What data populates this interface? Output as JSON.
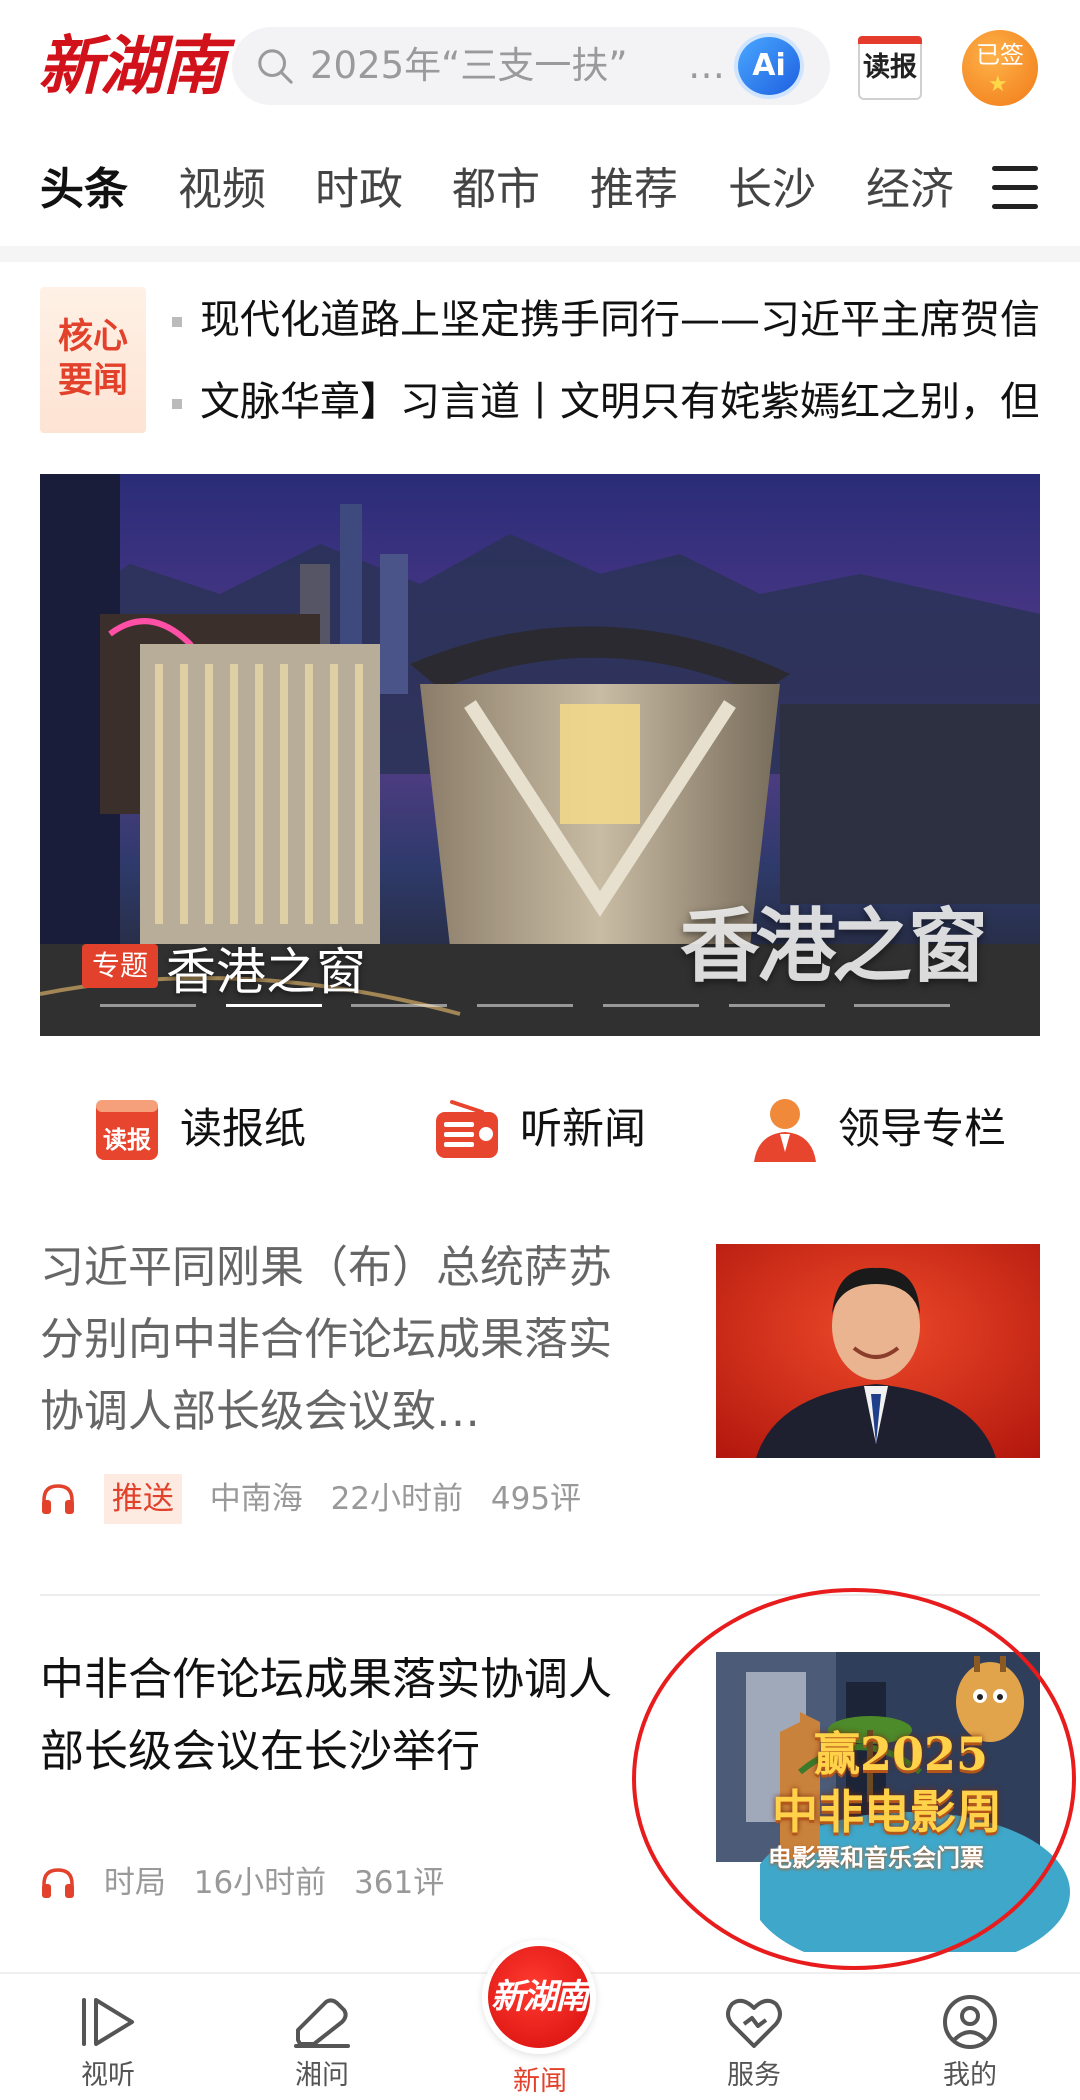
{
  "header": {
    "logo": "新湖南",
    "search_placeholder": "2025年“三支一扶”",
    "search_ellipsis": "…",
    "ai_label": "Ai",
    "dubao_label": "读报",
    "signed_label": "已签"
  },
  "tabs": [
    "头条",
    "视频",
    "时政",
    "都市",
    "推荐",
    "长沙",
    "经济"
  ],
  "core_news": {
    "badge": "核心要闻",
    "items": [
      "现代化道路上坚定携手同行——习近平主席贺信",
      "文脉华章】习言道丨文明只有姹紫嫣红之别，但"
    ]
  },
  "banner": {
    "tag": "专题",
    "title": "香港之窗",
    "overlay_text": "香港之窗",
    "slide_count": 7,
    "active_slide": 1
  },
  "quick_links": [
    {
      "label": "读报纸",
      "icon": "newspaper-icon"
    },
    {
      "label": "听新闻",
      "icon": "radio-icon"
    },
    {
      "label": "领导专栏",
      "icon": "leader-icon"
    }
  ],
  "articles": [
    {
      "title": "习近平同刚果（布）总统萨苏分别向中非合作论坛成果落实协调人部长级会议致…",
      "tag": "推送",
      "source": "中南海",
      "time": "22小时前",
      "comments": "495评"
    },
    {
      "title": "中非合作论坛成果落实协调人部长级会议在长沙举行",
      "source": "时局",
      "time": "16小时前",
      "comments": "361评",
      "ad_line1": "赢2025",
      "ad_line2": "中非电影周",
      "ad_line3": "电影票和音乐会门票"
    }
  ],
  "bottom_nav": [
    {
      "label": "视听",
      "icon": "play-icon"
    },
    {
      "label": "湘问",
      "icon": "chat-icon"
    },
    {
      "label": "新闻",
      "icon": "logo-icon",
      "active": true
    },
    {
      "label": "服务",
      "icon": "heart-icon"
    },
    {
      "label": "我的",
      "icon": "user-icon"
    }
  ],
  "bottom_center_logo": "新湖南",
  "colors": {
    "brand": "#d2121a",
    "accent": "#e2412b",
    "annotation": "#e81c1c"
  }
}
